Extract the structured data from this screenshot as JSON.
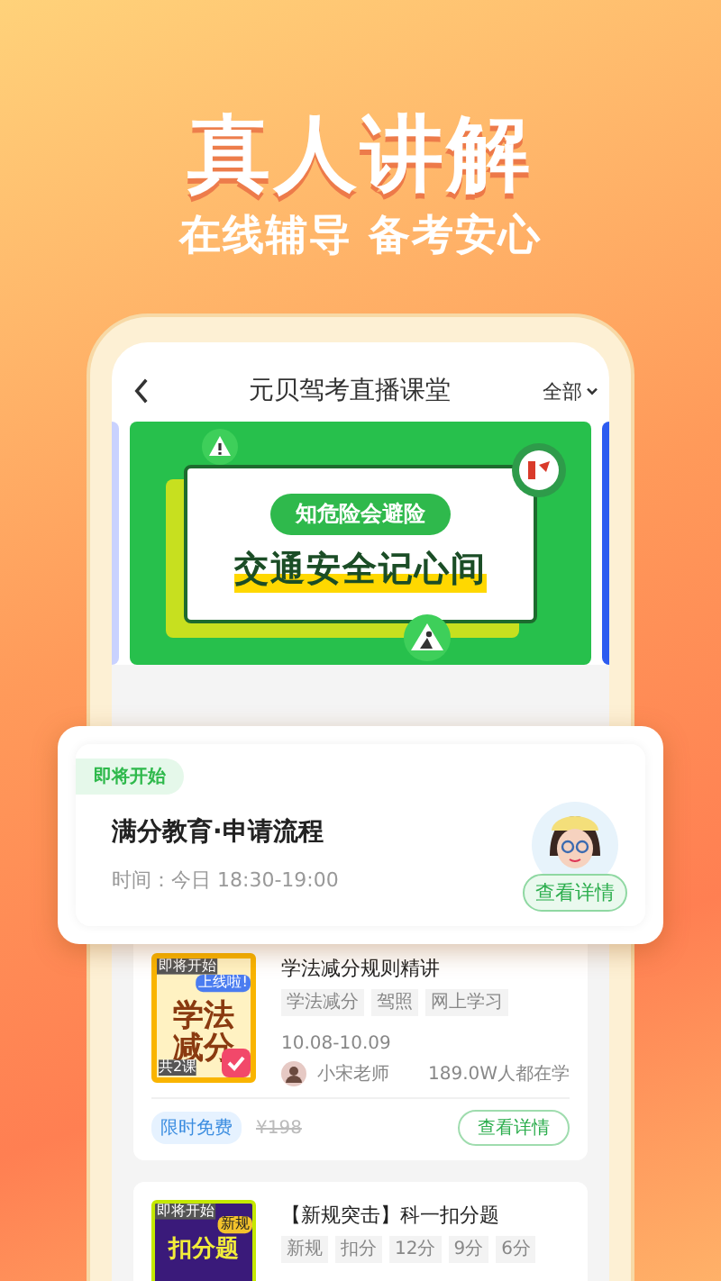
{
  "promo": {
    "headline": "真人讲解",
    "subtitle": "在线辅导 备考安心"
  },
  "header": {
    "title": "元贝驾考直播课堂",
    "filter": "全部"
  },
  "banner": {
    "badge": "知危险会避险",
    "headline": "交通安全记心间"
  },
  "live_card": {
    "status": "即将开始",
    "title": "满分教育·申请流程",
    "time": "时间：今日 18:30-19:00",
    "button": "查看详情"
  },
  "courses": [
    {
      "thumb": {
        "status": "即将开始",
        "tag": "上线啦!",
        "title": "学法减分",
        "footer": "共2课",
        "kind": "yellow"
      },
      "title": "学法减分规则精讲",
      "tags": [
        "学法减分",
        "驾照",
        "网上学习"
      ],
      "dates": "10.08-10.09",
      "teacher": "小宋老师",
      "learners": "189.0W人都在学",
      "price_tag": "限时免费",
      "old_price": "¥198",
      "button": "查看详情"
    },
    {
      "thumb": {
        "status": "即将开始",
        "tag": "新规",
        "title": "扣分题",
        "kind": "purple"
      },
      "title": "【新规突击】科一扣分题",
      "tags": [
        "新规",
        "扣分",
        "12分",
        "9分",
        "6分"
      ]
    }
  ]
}
